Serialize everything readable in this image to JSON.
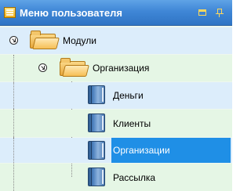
{
  "panel": {
    "title": "Меню пользователя",
    "icons": {
      "menu": "menu-list-icon",
      "restore": "restore-window-icon",
      "pin": "pin-icon"
    }
  },
  "tree": {
    "root": {
      "label": "Модули",
      "icon": "folder-open-icon",
      "expanded": true
    },
    "group": {
      "label": "Организация",
      "icon": "folder-open-icon",
      "expanded": true
    },
    "items": [
      {
        "label": "Деньги",
        "icon": "book-icon",
        "selected": false
      },
      {
        "label": "Клиенты",
        "icon": "book-icon",
        "selected": false
      },
      {
        "label": "Организации",
        "icon": "book-icon",
        "selected": true
      },
      {
        "label": "Рассылка",
        "icon": "book-icon",
        "selected": false
      }
    ]
  },
  "colors": {
    "header": "#3f86d6",
    "selection": "#1f8fe6",
    "row_blue": "#dcedfb",
    "row_green": "#e5f6e5"
  }
}
